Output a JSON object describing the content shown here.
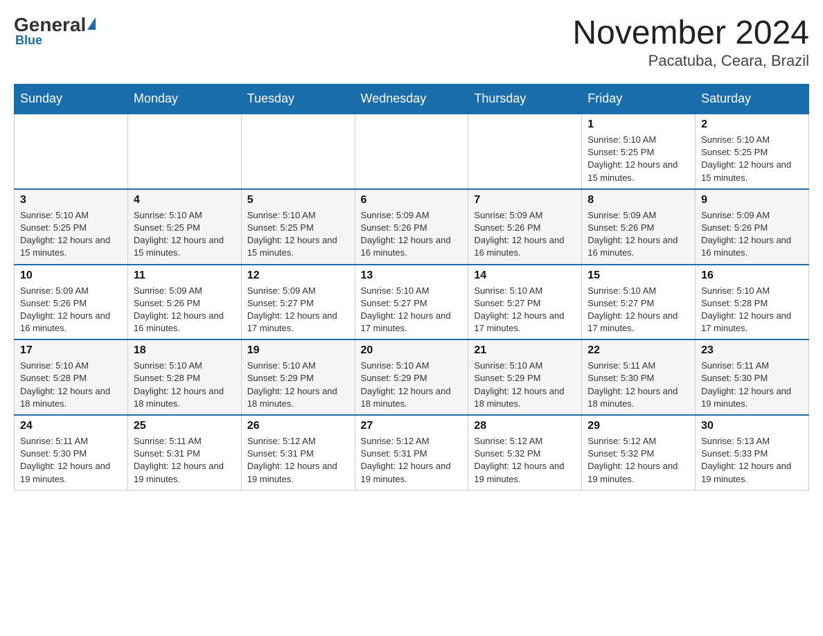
{
  "header": {
    "logo_general": "General",
    "logo_blue": "Blue",
    "title": "November 2024",
    "location": "Pacatuba, Ceara, Brazil"
  },
  "days_of_week": [
    "Sunday",
    "Monday",
    "Tuesday",
    "Wednesday",
    "Thursday",
    "Friday",
    "Saturday"
  ],
  "weeks": [
    {
      "days": [
        {
          "date": "",
          "empty": true
        },
        {
          "date": "",
          "empty": true
        },
        {
          "date": "",
          "empty": true
        },
        {
          "date": "",
          "empty": true
        },
        {
          "date": "",
          "empty": true
        },
        {
          "date": "1",
          "sunrise": "Sunrise: 5:10 AM",
          "sunset": "Sunset: 5:25 PM",
          "daylight": "Daylight: 12 hours and 15 minutes."
        },
        {
          "date": "2",
          "sunrise": "Sunrise: 5:10 AM",
          "sunset": "Sunset: 5:25 PM",
          "daylight": "Daylight: 12 hours and 15 minutes."
        }
      ]
    },
    {
      "days": [
        {
          "date": "3",
          "sunrise": "Sunrise: 5:10 AM",
          "sunset": "Sunset: 5:25 PM",
          "daylight": "Daylight: 12 hours and 15 minutes."
        },
        {
          "date": "4",
          "sunrise": "Sunrise: 5:10 AM",
          "sunset": "Sunset: 5:25 PM",
          "daylight": "Daylight: 12 hours and 15 minutes."
        },
        {
          "date": "5",
          "sunrise": "Sunrise: 5:10 AM",
          "sunset": "Sunset: 5:25 PM",
          "daylight": "Daylight: 12 hours and 15 minutes."
        },
        {
          "date": "6",
          "sunrise": "Sunrise: 5:09 AM",
          "sunset": "Sunset: 5:26 PM",
          "daylight": "Daylight: 12 hours and 16 minutes."
        },
        {
          "date": "7",
          "sunrise": "Sunrise: 5:09 AM",
          "sunset": "Sunset: 5:26 PM",
          "daylight": "Daylight: 12 hours and 16 minutes."
        },
        {
          "date": "8",
          "sunrise": "Sunrise: 5:09 AM",
          "sunset": "Sunset: 5:26 PM",
          "daylight": "Daylight: 12 hours and 16 minutes."
        },
        {
          "date": "9",
          "sunrise": "Sunrise: 5:09 AM",
          "sunset": "Sunset: 5:26 PM",
          "daylight": "Daylight: 12 hours and 16 minutes."
        }
      ]
    },
    {
      "days": [
        {
          "date": "10",
          "sunrise": "Sunrise: 5:09 AM",
          "sunset": "Sunset: 5:26 PM",
          "daylight": "Daylight: 12 hours and 16 minutes."
        },
        {
          "date": "11",
          "sunrise": "Sunrise: 5:09 AM",
          "sunset": "Sunset: 5:26 PM",
          "daylight": "Daylight: 12 hours and 16 minutes."
        },
        {
          "date": "12",
          "sunrise": "Sunrise: 5:09 AM",
          "sunset": "Sunset: 5:27 PM",
          "daylight": "Daylight: 12 hours and 17 minutes."
        },
        {
          "date": "13",
          "sunrise": "Sunrise: 5:10 AM",
          "sunset": "Sunset: 5:27 PM",
          "daylight": "Daylight: 12 hours and 17 minutes."
        },
        {
          "date": "14",
          "sunrise": "Sunrise: 5:10 AM",
          "sunset": "Sunset: 5:27 PM",
          "daylight": "Daylight: 12 hours and 17 minutes."
        },
        {
          "date": "15",
          "sunrise": "Sunrise: 5:10 AM",
          "sunset": "Sunset: 5:27 PM",
          "daylight": "Daylight: 12 hours and 17 minutes."
        },
        {
          "date": "16",
          "sunrise": "Sunrise: 5:10 AM",
          "sunset": "Sunset: 5:28 PM",
          "daylight": "Daylight: 12 hours and 17 minutes."
        }
      ]
    },
    {
      "days": [
        {
          "date": "17",
          "sunrise": "Sunrise: 5:10 AM",
          "sunset": "Sunset: 5:28 PM",
          "daylight": "Daylight: 12 hours and 18 minutes."
        },
        {
          "date": "18",
          "sunrise": "Sunrise: 5:10 AM",
          "sunset": "Sunset: 5:28 PM",
          "daylight": "Daylight: 12 hours and 18 minutes."
        },
        {
          "date": "19",
          "sunrise": "Sunrise: 5:10 AM",
          "sunset": "Sunset: 5:29 PM",
          "daylight": "Daylight: 12 hours and 18 minutes."
        },
        {
          "date": "20",
          "sunrise": "Sunrise: 5:10 AM",
          "sunset": "Sunset: 5:29 PM",
          "daylight": "Daylight: 12 hours and 18 minutes."
        },
        {
          "date": "21",
          "sunrise": "Sunrise: 5:10 AM",
          "sunset": "Sunset: 5:29 PM",
          "daylight": "Daylight: 12 hours and 18 minutes."
        },
        {
          "date": "22",
          "sunrise": "Sunrise: 5:11 AM",
          "sunset": "Sunset: 5:30 PM",
          "daylight": "Daylight: 12 hours and 18 minutes."
        },
        {
          "date": "23",
          "sunrise": "Sunrise: 5:11 AM",
          "sunset": "Sunset: 5:30 PM",
          "daylight": "Daylight: 12 hours and 19 minutes."
        }
      ]
    },
    {
      "days": [
        {
          "date": "24",
          "sunrise": "Sunrise: 5:11 AM",
          "sunset": "Sunset: 5:30 PM",
          "daylight": "Daylight: 12 hours and 19 minutes."
        },
        {
          "date": "25",
          "sunrise": "Sunrise: 5:11 AM",
          "sunset": "Sunset: 5:31 PM",
          "daylight": "Daylight: 12 hours and 19 minutes."
        },
        {
          "date": "26",
          "sunrise": "Sunrise: 5:12 AM",
          "sunset": "Sunset: 5:31 PM",
          "daylight": "Daylight: 12 hours and 19 minutes."
        },
        {
          "date": "27",
          "sunrise": "Sunrise: 5:12 AM",
          "sunset": "Sunset: 5:31 PM",
          "daylight": "Daylight: 12 hours and 19 minutes."
        },
        {
          "date": "28",
          "sunrise": "Sunrise: 5:12 AM",
          "sunset": "Sunset: 5:32 PM",
          "daylight": "Daylight: 12 hours and 19 minutes."
        },
        {
          "date": "29",
          "sunrise": "Sunrise: 5:12 AM",
          "sunset": "Sunset: 5:32 PM",
          "daylight": "Daylight: 12 hours and 19 minutes."
        },
        {
          "date": "30",
          "sunrise": "Sunrise: 5:13 AM",
          "sunset": "Sunset: 5:33 PM",
          "daylight": "Daylight: 12 hours and 19 minutes."
        }
      ]
    }
  ]
}
